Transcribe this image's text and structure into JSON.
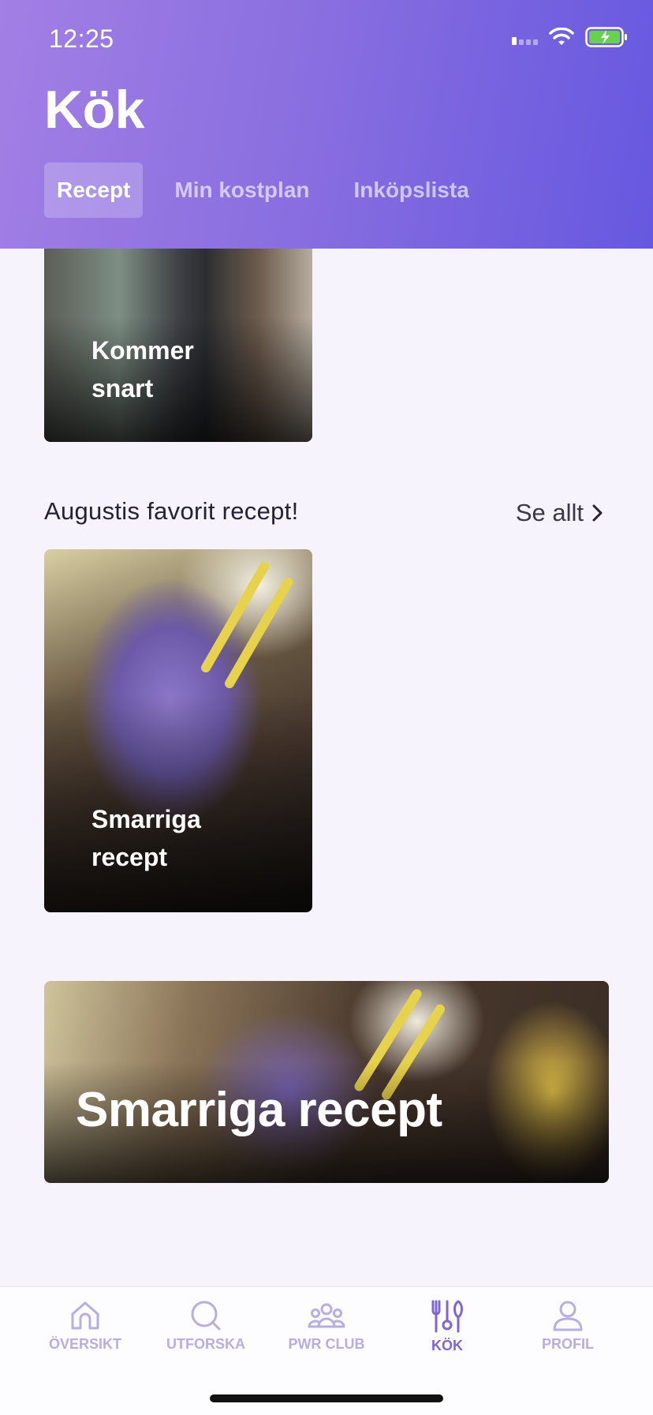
{
  "status_bar": {
    "time": "12:25"
  },
  "header": {
    "title": "Kök",
    "tabs": [
      {
        "label": "Recept",
        "active": true
      },
      {
        "label": "Min kostplan",
        "active": false
      },
      {
        "label": "Inköpslista",
        "active": false
      }
    ]
  },
  "cards": {
    "coming_soon": "Kommer snart"
  },
  "section": {
    "title": "Augustis favorit recept!",
    "see_all": "Se allt"
  },
  "recipe_card": {
    "label": "Smarriga recept"
  },
  "banner": {
    "label": "Smarriga recept"
  },
  "tabbar": {
    "items": [
      {
        "label": "ÖVERSIKT",
        "icon": "home-icon"
      },
      {
        "label": "UTFORSKA",
        "icon": "search-icon"
      },
      {
        "label": "PWR CLUB",
        "icon": "group-icon"
      },
      {
        "label": "KÖK",
        "icon": "kitchen-utensils-icon",
        "active": true
      },
      {
        "label": "PROFIL",
        "icon": "profile-icon"
      }
    ]
  },
  "colors": {
    "header_gradient_start": "#a27fe4",
    "header_gradient_end": "#6658e0",
    "active_tab_accent": "#7e66d4",
    "inactive_tab": "#b8aee0",
    "background": "#f6f3fd"
  }
}
